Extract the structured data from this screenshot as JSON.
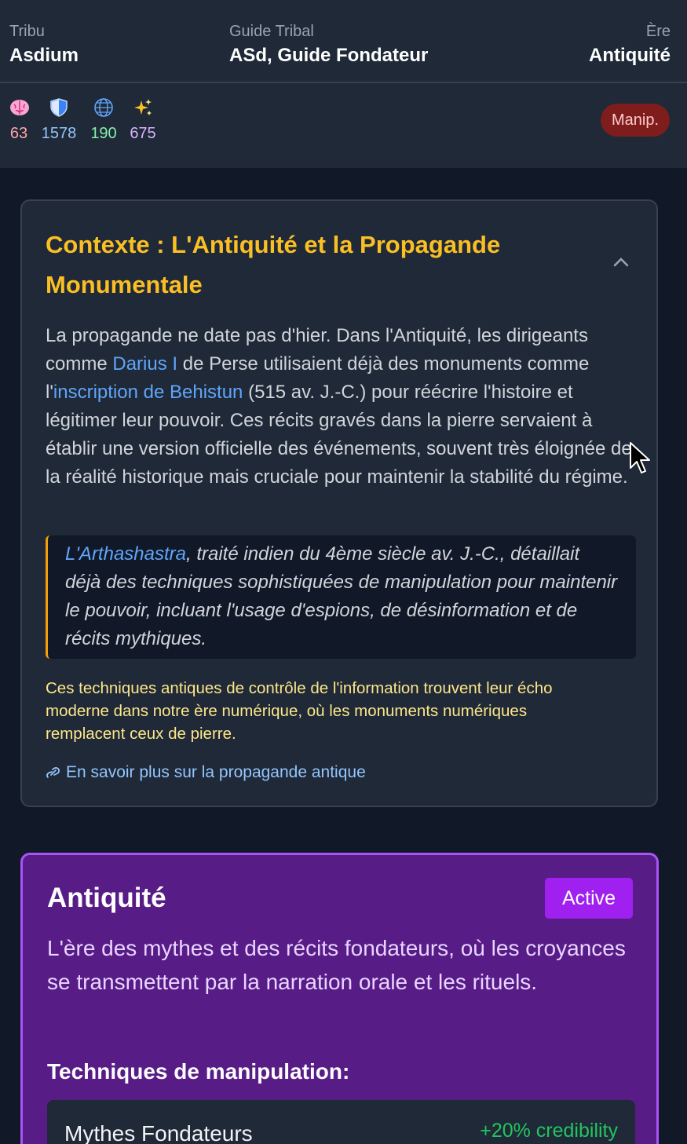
{
  "header": {
    "tribe_label": "Tribu",
    "tribe_name": "Asdium",
    "guide_label": "Guide Tribal",
    "guide_name": "ASd, Guide Fondateur",
    "era_label": "Ère",
    "era_name": "Antiquité"
  },
  "stats": [
    {
      "icon": "brain-icon",
      "value": "63",
      "color": "#fca5a5"
    },
    {
      "icon": "shield-icon",
      "value": "1578",
      "color": "#93c5fd"
    },
    {
      "icon": "globe-icon",
      "value": "190",
      "color": "#86efac"
    },
    {
      "icon": "sparkles-icon",
      "value": "675",
      "color": "#d8b4fe"
    }
  ],
  "manip_badge": "Manip.",
  "context": {
    "title": "Contexte : L'Antiquité et la Propagande Monumentale",
    "p_part1": "La propagande ne date pas d'hier. Dans l'Antiquité, les dirigeants comme ",
    "link_darius": "Darius I",
    "p_part2": " de Perse utilisaient déjà des monuments comme l'",
    "link_behistun": "inscription de Behistun",
    "p_part3": " (515 av. J.-C.) pour réécrire l'histoire et légitimer leur pouvoir. Ces récits gravés dans la pierre servaient à établir une version officielle des événements, souvent très éloignée de la réalité historique mais cruciale pour maintenir la stabilité du régime.",
    "quote_link": "L'Arthashastra",
    "quote_rest": ", traité indien du 4ème siècle av. J.-C., détaillait déjà des techniques sophistiquées de manipulation pour maintenir le pouvoir, incluant l'usage d'espions, de désinformation et de récits mythiques.",
    "note": "Ces techniques antiques de contrôle de l'information trouvent leur écho moderne dans notre ère numérique, où les monuments numériques remplacent ceux de pierre.",
    "learn_more": "En savoir plus sur la propagande antique"
  },
  "era_card": {
    "title": "Antiquité",
    "status": "Active",
    "description": "L'ère des mythes et des récits fondateurs, où les croyances se transmettent par la narration orale et les rituels.",
    "techniques_heading": "Techniques de manipulation:",
    "techniques": [
      {
        "name": "Mythes Fondateurs",
        "effect": "+20% credibility"
      }
    ]
  }
}
